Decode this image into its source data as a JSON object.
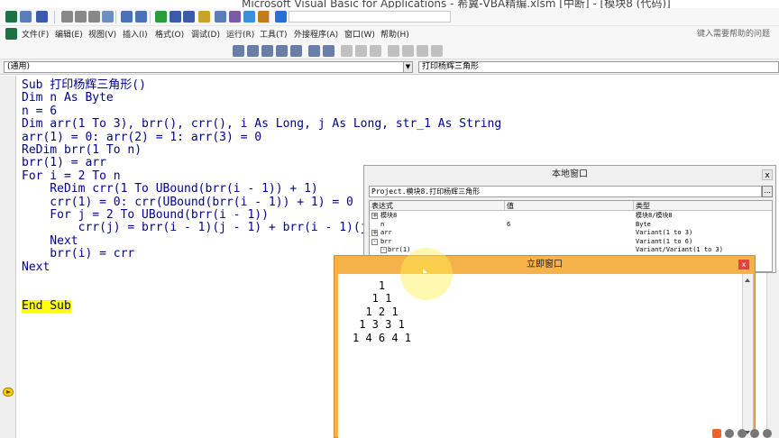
{
  "window": {
    "title": "Microsoft Visual Basic for Applications - 希翼-VBA精编.xlsm [中断] - [模块8 (代码)]"
  },
  "menubar": {
    "items": [
      "文件(F)",
      "编辑(E)",
      "视图(V)",
      "插入(I)",
      "格式(O)",
      "调试(D)",
      "运行(R)",
      "工具(T)",
      "外接程序(A)",
      "窗口(W)",
      "帮助(H)"
    ],
    "help_placeholder": "键入需要帮助的问题"
  },
  "toolbar": {
    "icons": [
      "excel-icon",
      "insert-userform-icon",
      "save-icon",
      "cut-icon",
      "copy-icon",
      "paste-icon",
      "find-icon",
      "undo-icon",
      "redo-icon",
      "run-icon",
      "break-icon",
      "reset-icon",
      "design-mode-icon",
      "project-explorer-icon",
      "properties-icon",
      "object-browser-icon",
      "toolbox-icon",
      "help-icon"
    ]
  },
  "combos": {
    "object": "(通用)",
    "procedure": "打印杨辉三角形"
  },
  "code": {
    "lines": [
      "Sub 打印杨辉三角形()",
      "Dim n As Byte",
      "n = 6",
      "Dim arr(1 To 3), brr(), crr(), i As Long, j As Long, str_1 As String",
      "arr(1) = 0: arr(2) = 1: arr(3) = 0",
      "ReDim brr(1 To n)",
      "brr(1) = arr",
      "For i = 2 To n",
      "    ReDim crr(1 To UBound(brr(i - 1)) + 1)",
      "    crr(1) = 0: crr(UBound(brr(i - 1)) + 1) = 0",
      "    For j = 2 To UBound(brr(i - 1))",
      "        crr(j) = brr(i - 1)(j - 1) + brr(i - 1)(j)",
      "    Next",
      "    brr(i) = crr",
      "Next",
      "",
      "",
      "End Sub"
    ],
    "current_line": "End Sub"
  },
  "locals": {
    "title": "本地窗口",
    "path": "Project.模块8.打印杨辉三角形",
    "columns": [
      "表达式",
      "值",
      "类型"
    ],
    "rows": [
      {
        "expr": "模块8",
        "value": "",
        "type": "模块8/模块8"
      },
      {
        "expr": "n",
        "value": "6",
        "type": "Byte"
      },
      {
        "expr": "arr",
        "value": "",
        "type": "Variant(1 to 3)"
      },
      {
        "expr": "brr",
        "value": "",
        "type": "Variant(1 to 6)"
      },
      {
        "expr": "brr(1)",
        "value": "",
        "type": "Variant/Variant(1 to 3)"
      }
    ]
  },
  "immediate": {
    "title": "立即窗口",
    "lines": [
      "    1",
      "   1 1",
      "  1 2 1",
      " 1 3 3 1",
      "1 4 6 4 1"
    ]
  },
  "colors": {
    "immediate_frame": "#f6b24a",
    "highlight": "#ffff00",
    "keyword": "#00008b"
  }
}
